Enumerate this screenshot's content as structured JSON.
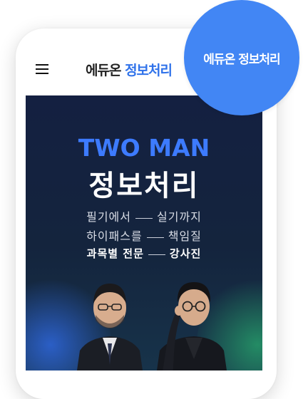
{
  "header": {
    "menu_icon": "hamburger-menu-icon",
    "logo_part1": "에듀온",
    "logo_part2": "정보처리"
  },
  "badge": {
    "text": "에듀온 정보처리"
  },
  "banner": {
    "title_en": "TWO MAN",
    "title_ko": "정보처리",
    "line1": {
      "left": "필기에서",
      "right": "실기까지"
    },
    "line2": {
      "left": "하이패스를",
      "right": "책임질"
    },
    "line3": {
      "left": "과목별 전문",
      "right": "강사진"
    },
    "colors": {
      "title_en": "#3d7bff",
      "background": "#142041",
      "badge": "#4286f4"
    }
  }
}
